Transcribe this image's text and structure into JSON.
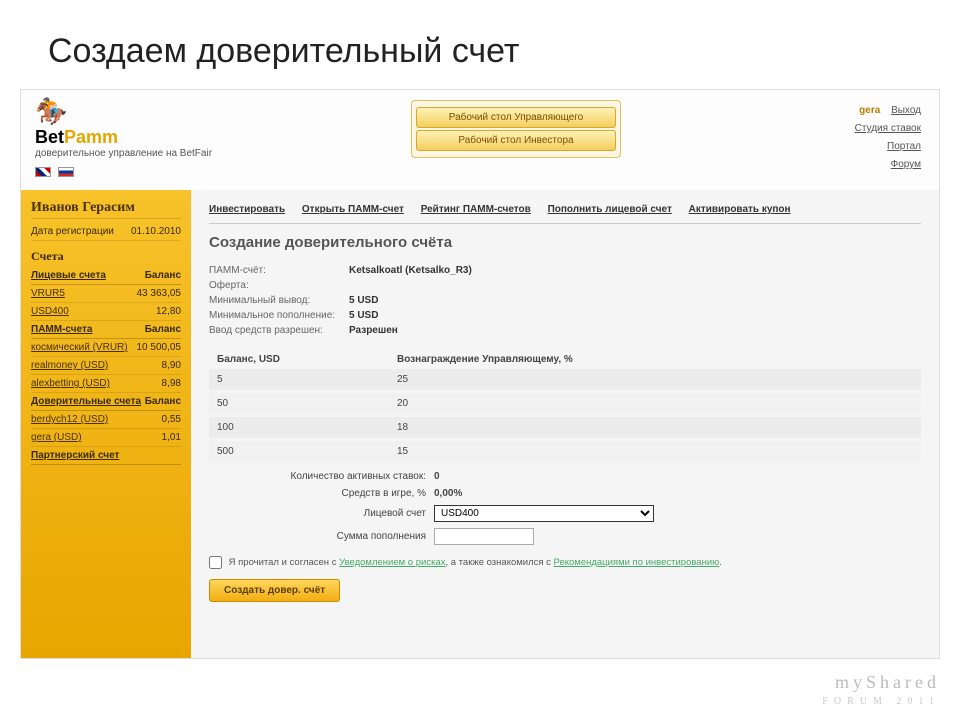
{
  "slide": {
    "title": "Создаем доверительный счет"
  },
  "logo": {
    "brand_a": "Bet",
    "brand_b": "Pamm",
    "subtitle": "доверительное управление на BetFair"
  },
  "topButtons": {
    "manager": "Рабочий стол Управляющего",
    "investor": "Рабочий стол Инвестора"
  },
  "topLinks": {
    "user": "gera",
    "logout": "Выход",
    "studio": "Студия ставок",
    "portal": "Портал",
    "forum": "Форум"
  },
  "sidebar": {
    "username": "Иванов Герасим",
    "reg_label": "Дата регистрации",
    "reg_date": "01.10.2010",
    "accounts_title": "Счета",
    "h_personal": "Лицевые счета",
    "h_balance": "Баланс",
    "personal": [
      {
        "name": "VRUR5",
        "bal": "43 363,05"
      },
      {
        "name": "USD400",
        "bal": "12,80"
      }
    ],
    "h_pamm": "ПАММ-счета",
    "pamm": [
      {
        "name": "космический (VRUR)",
        "bal": "10 500,05"
      },
      {
        "name": "realmoney (USD)",
        "bal": "8,90"
      },
      {
        "name": "alexbetting (USD)",
        "bal": "8,98"
      }
    ],
    "h_trust": "Доверительные счета",
    "trust": [
      {
        "name": "berdych12 (USD)",
        "bal": "0,55"
      },
      {
        "name": "gera (USD)",
        "bal": "1,01"
      }
    ],
    "h_partner": "Партнерский счет"
  },
  "menu": {
    "invest": "Инвестировать",
    "open": "Открыть ПАММ-счет",
    "rating": "Рейтинг ПАММ-счетов",
    "topup": "Пополнить лицевой счет",
    "coupon": "Активировать купон"
  },
  "page": {
    "title": "Создание доверительного счёта",
    "k_pamm": "ПАММ-счёт:",
    "v_pamm": "Ketsalkoatl (Ketsalko_R3)",
    "k_offer": "Оферта:",
    "v_offer": "",
    "k_minout": "Минимальный вывод:",
    "v_minout": "5 USD",
    "k_minin": "Минимальное пополнение:",
    "v_minin": "5 USD",
    "k_allow": "Ввод средств разрешен:",
    "v_allow": "Разрешен",
    "th_balance": "Баланс, USD",
    "th_reward": "Вознаграждение Управляющему, %",
    "tiers": [
      {
        "b": "5",
        "r": "25"
      },
      {
        "b": "50",
        "r": "20"
      },
      {
        "b": "100",
        "r": "18"
      },
      {
        "b": "500",
        "r": "15"
      }
    ],
    "k_active": "Количество активных ставок:",
    "v_active": "0",
    "k_inplay": "Средств в игре, %",
    "v_inplay": "0,00%",
    "k_acct": "Лицевой счет",
    "acct_selected": "USD400",
    "k_sum": "Сумма пополнения",
    "agree_pre": "Я прочитал и согласен с ",
    "agree_link1": "Уведомлением о рисках",
    "agree_mid": ", а также ознакомился с ",
    "agree_link2": "Рекомендациями по инвестированию",
    "agree_post": ".",
    "create": "Создать довер. счёт"
  },
  "watermark": {
    "main": "myShared",
    "sub": "FORUM 2011"
  }
}
